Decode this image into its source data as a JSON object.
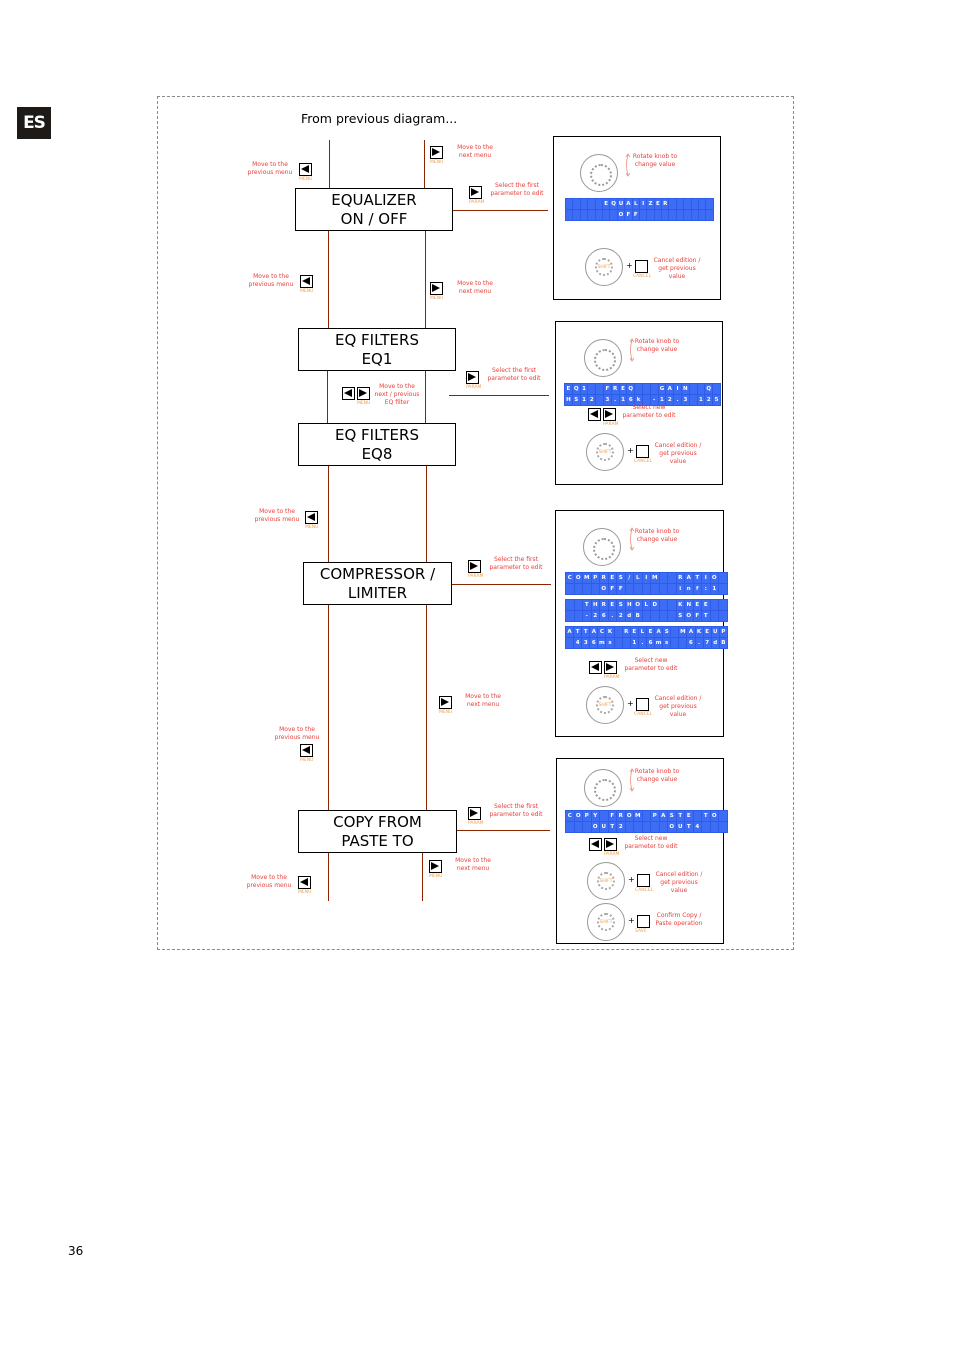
{
  "page": {
    "language_tab": "ES",
    "page_number": "36",
    "from_previous": "From previous diagram..."
  },
  "colors": {
    "flow_line": "#8b2500",
    "note_text": "#e8403c",
    "key_label": "#f0a050",
    "lcd_bg": "#3d6cf5"
  },
  "menus": [
    {
      "line1": "EQUALIZER",
      "line2": "ON / OFF"
    },
    {
      "line1": "EQ FILTERS",
      "line2": "EQ1"
    },
    {
      "line1": "EQ FILTERS",
      "line2": "EQ8"
    },
    {
      "line1": "COMPRESSOR /",
      "line2": "LIMITER"
    },
    {
      "line1": "COPY FROM",
      "line2": "PASTE TO"
    }
  ],
  "notes": {
    "prev_menu": "Move to the previous menu",
    "next_menu": "Move to the next menu",
    "first_param": "Select the first parameter to edit",
    "next_prev_eq": "Move to the next / previous EQ filter",
    "rotate": "Rotate knob to change value",
    "select_new": "Select new parameter to edit",
    "cancel": "Cancel edition / get previous value",
    "confirm": "Confirm Copy / Paste operation"
  },
  "keys": {
    "menu": "MENU",
    "param": "PARAM",
    "shift": "SHIFT",
    "cancel": "CANCEL",
    "save": "SAVE"
  },
  "lcd": {
    "equalizer": [
      [
        "",
        "",
        "",
        "",
        "",
        "E",
        "Q",
        "U",
        "A",
        "L",
        "I",
        "Z",
        "E",
        "R",
        "",
        "",
        "",
        "",
        "",
        ""
      ],
      [
        "",
        "",
        "",
        "",
        "",
        "",
        "",
        "O",
        "F",
        "F",
        "",
        "",
        "",
        "",
        "",
        "",
        "",
        "",
        "",
        ""
      ]
    ],
    "eq_filter": [
      [
        "E",
        "Q",
        "1",
        "",
        "",
        "F",
        "R",
        "E",
        "Q",
        "",
        "",
        "",
        "G",
        "A",
        "I",
        "N",
        "",
        "",
        "Q",
        ""
      ],
      [
        "H",
        "S",
        "1",
        "2",
        "",
        "3",
        ".",
        "1",
        "6",
        "k",
        "",
        "-",
        "1",
        "2",
        ".",
        "3",
        "",
        "1",
        "2",
        "5"
      ]
    ],
    "compressor": [
      [
        [
          "C",
          "O",
          "M",
          "P",
          "R",
          "E",
          "S",
          "/",
          "L",
          "I",
          "M",
          "",
          "",
          "R",
          "A",
          "T",
          "I",
          "O",
          ""
        ],
        [
          "",
          "",
          "",
          "",
          "O",
          "F",
          "F",
          "",
          "",
          "",
          "",
          "",
          "",
          "i",
          "n",
          "f",
          ":",
          "1",
          ""
        ]
      ],
      [
        [
          "",
          "",
          "T",
          "H",
          "R",
          "E",
          "S",
          "H",
          "O",
          "L",
          "D",
          "",
          "",
          "K",
          "N",
          "E",
          "E",
          "",
          ""
        ],
        [
          "",
          "",
          "-",
          "2",
          "6",
          ".",
          "2",
          "d",
          "B",
          "",
          "",
          "",
          "",
          "S",
          "O",
          "F",
          "T",
          "",
          ""
        ]
      ],
      [
        [
          "A",
          "T",
          "T",
          "A",
          "C",
          "K",
          "",
          "R",
          "E",
          "L",
          "E",
          "A",
          "S",
          "",
          "M",
          "A",
          "K",
          "E",
          "U",
          "P"
        ],
        [
          "",
          "4",
          "3",
          "6",
          "m",
          "s",
          "",
          "",
          "1",
          ".",
          "6",
          "m",
          "s",
          "",
          "",
          "6",
          ".",
          "7",
          "d",
          "B"
        ]
      ]
    ],
    "copy_paste": [
      [
        "C",
        "O",
        "P",
        "Y",
        "",
        "F",
        "R",
        "O",
        "M",
        "",
        "P",
        "A",
        "S",
        "T",
        "E",
        "",
        "T",
        "O",
        ""
      ],
      [
        "",
        "",
        "",
        "O",
        "U",
        "T",
        "2",
        "",
        "",
        "",
        "",
        "",
        "O",
        "U",
        "T",
        "4",
        "",
        "",
        ""
      ]
    ]
  }
}
